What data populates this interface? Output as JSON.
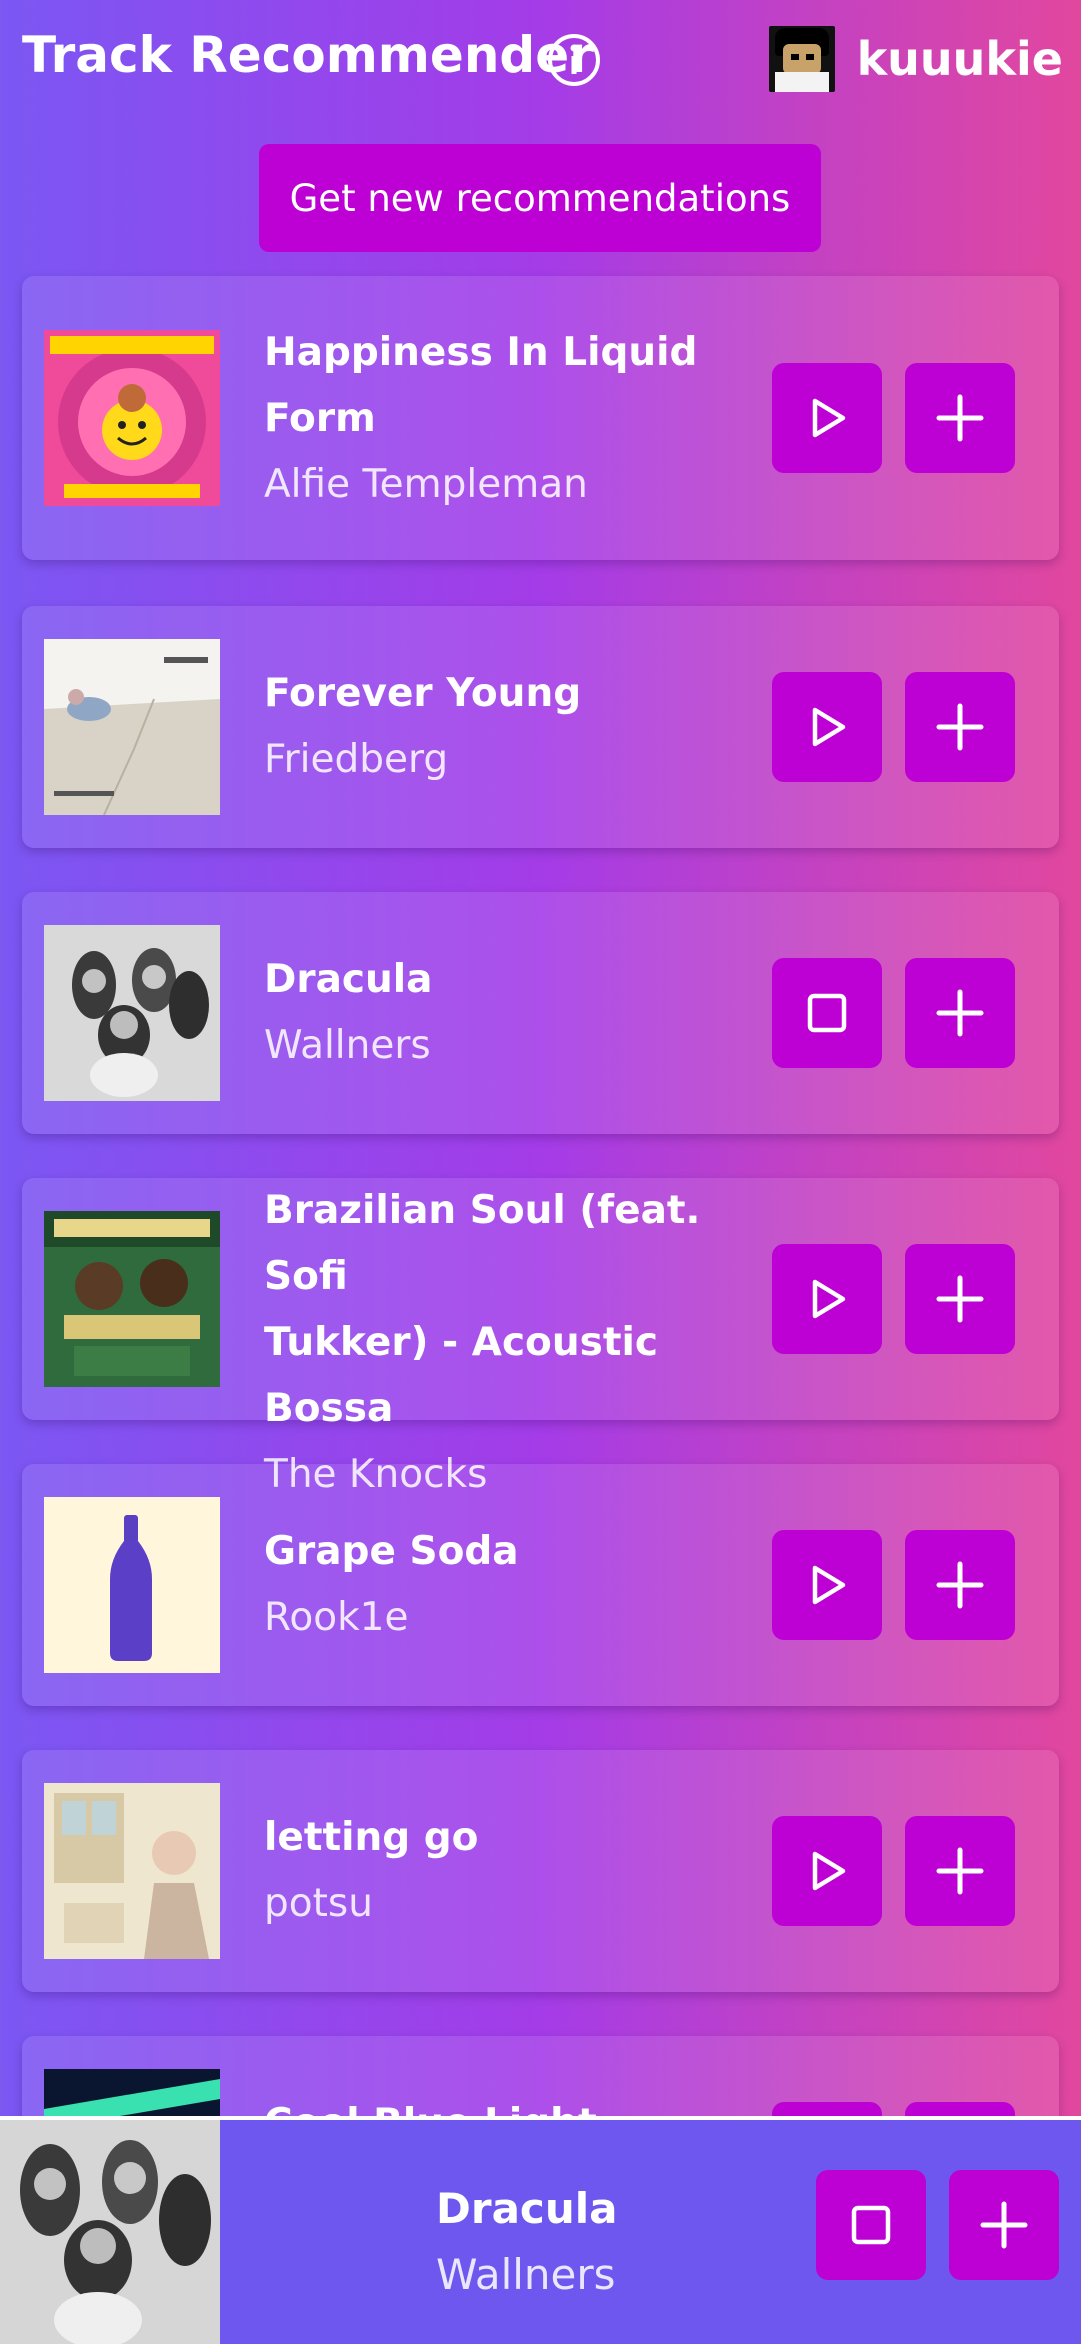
{
  "header": {
    "title": "Track Recommender",
    "username": "kuuukie"
  },
  "actions": {
    "get_new": "Get new recommendations"
  },
  "tracks": [
    {
      "title_lines": [
        "Happiness In Liquid",
        "Form"
      ],
      "artist": "Alfie Templeman",
      "state": "play"
    },
    {
      "title_lines": [
        "Forever Young"
      ],
      "artist": "Friedberg",
      "state": "play"
    },
    {
      "title_lines": [
        "Dracula"
      ],
      "artist": "Wallners",
      "state": "stop"
    },
    {
      "title_lines": [
        "Brazilian Soul (feat. Sofi",
        "Tukker) - Acoustic Bossa"
      ],
      "artist": "The Knocks",
      "state": "play"
    },
    {
      "title_lines": [
        "Grape Soda"
      ],
      "artist": "Rook1e",
      "state": "play"
    },
    {
      "title_lines": [
        "letting go"
      ],
      "artist": "potsu",
      "state": "play"
    },
    {
      "title_lines": [
        "Cool Blue Light"
      ],
      "artist": "",
      "state": "play"
    }
  ],
  "now_playing": {
    "title": "Dracula",
    "artist": "Wallners",
    "state": "stop"
  },
  "colors": {
    "accent": "#bd00d3",
    "now_playing_bg": "#6e57ef"
  }
}
